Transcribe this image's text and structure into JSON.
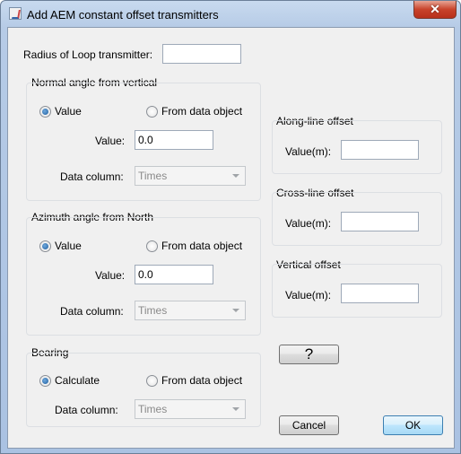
{
  "window": {
    "title": "Add AEM constant offset transmitters",
    "close_glyph": "✕"
  },
  "radius": {
    "label": "Radius of Loop transmitter:",
    "value": ""
  },
  "normal": {
    "title": "Normal angle from vertical",
    "opt_value": "Value",
    "opt_data": "From data object",
    "value_label": "Value:",
    "value": "0.0",
    "column_label": "Data column:",
    "column_value": "Times"
  },
  "azimuth": {
    "title": "Azimuth angle from North",
    "opt_value": "Value",
    "opt_data": "From data object",
    "value_label": "Value:",
    "value": "0.0",
    "column_label": "Data column:",
    "column_value": "Times"
  },
  "bearing": {
    "title": "Bearing",
    "opt_calc": "Calculate",
    "opt_data": "From data object",
    "column_label": "Data column:",
    "column_value": "Times"
  },
  "along": {
    "title": "Along-line offset",
    "label": "Value(m):",
    "value": ""
  },
  "cross": {
    "title": "Cross-line offset",
    "label": "Value(m):",
    "value": ""
  },
  "vertical": {
    "title": "Vertical offset",
    "label": "Value(m):",
    "value": ""
  },
  "buttons": {
    "help": "?",
    "cancel": "Cancel",
    "ok": "OK"
  },
  "colors": {
    "title_bar": "#b6cbe6",
    "close_button": "#c8432b",
    "panel": "#f0f0f0"
  }
}
